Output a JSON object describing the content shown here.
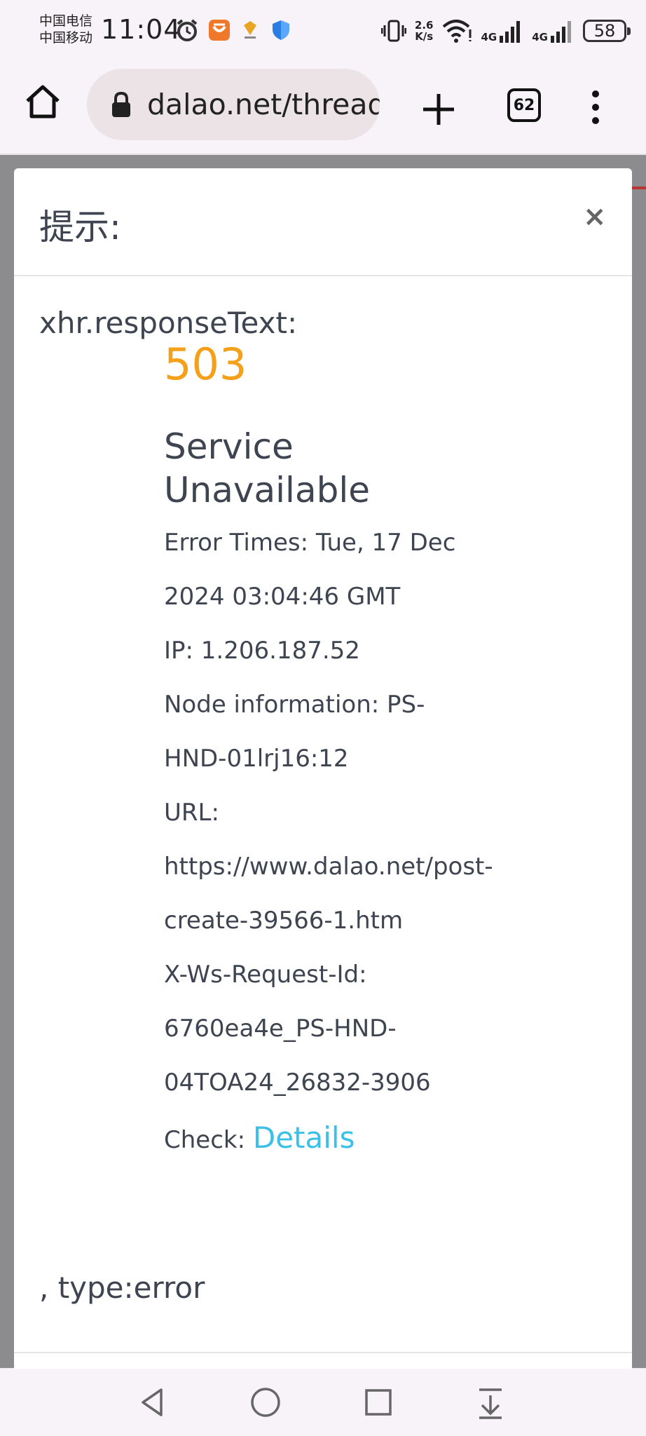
{
  "status_bar": {
    "carrier_1": "中国电信",
    "carrier_2": "中国移动",
    "time": "11:04",
    "net_speed_value": "2.6",
    "net_speed_unit": "K/s",
    "network_1": "4G",
    "network_2": "4G",
    "battery": "58",
    "icons": [
      "alarm-icon",
      "shield-app-icon",
      "crown-app-icon",
      "security-shield-icon",
      "vibrate-icon",
      "wifi-icon",
      "signal-icon",
      "signal-icon",
      "battery-icon"
    ]
  },
  "browser": {
    "url": "dalao.net/thread",
    "tab_count": "62",
    "icons": [
      "home-icon",
      "lock-icon",
      "new-tab-plus-icon",
      "menu-dots-icon"
    ]
  },
  "modal": {
    "title": "提示:",
    "close": "×",
    "label": "xhr.responseText:",
    "error_code": "503",
    "error_title_line1": "Service",
    "error_title_line2": "Unavailable",
    "lines": [
      "Error Times: Tue, 17 Dec",
      "2024 03:04:46 GMT",
      "IP: 1.206.187.52",
      "Node information: PS-",
      "HND-01lrj16:12",
      "URL:",
      "https://www.dalao.net/post-",
      "create-39566-1.htm",
      "X-Ws-Request-Id:",
      "6760ea4e_PS-HND-",
      "04TOA24_26832-3906"
    ],
    "check_label": "Check: ",
    "check_link": "Details",
    "type_text": ", type:error"
  },
  "colors": {
    "accent_code": "#f5a01a",
    "link": "#3bc0e8",
    "text": "#3e4450"
  },
  "nav_bar": {
    "icons": [
      "back-triangle-icon",
      "home-circle-icon",
      "recents-square-icon",
      "download-arrow-icon"
    ]
  }
}
